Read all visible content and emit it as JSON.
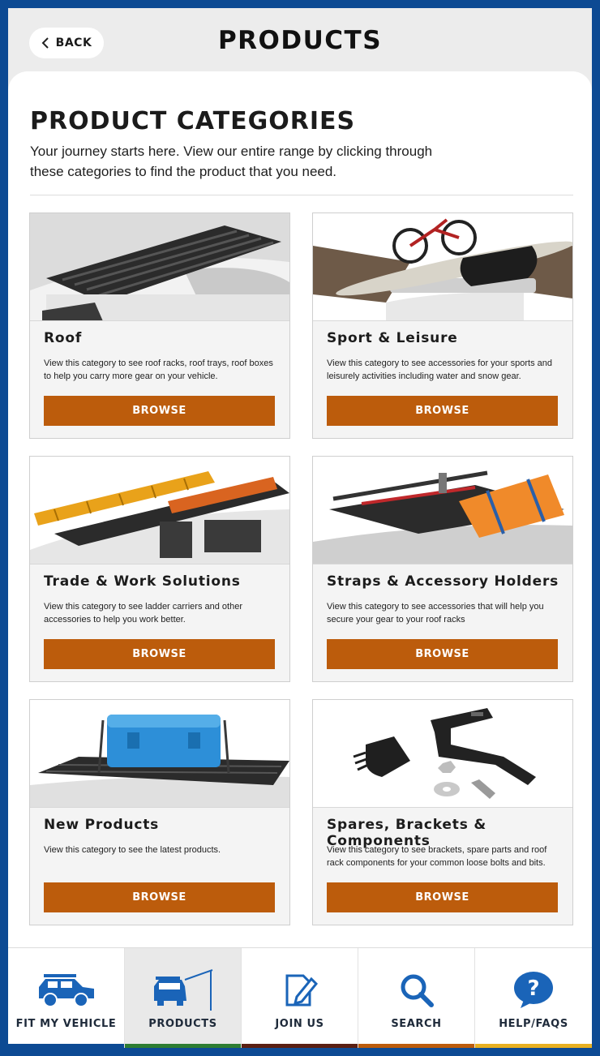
{
  "header": {
    "back_label": "BACK",
    "title": "PRODUCTS"
  },
  "section": {
    "title": "PRODUCT CATEGORIES",
    "intro": "Your journey starts here. View our entire range by clicking through these categories to find the product that you need."
  },
  "categories": [
    {
      "title": "Roof",
      "description": "View this category to see roof racks, roof trays, roof boxes to help you carry more gear on your vehicle.",
      "button": "BROWSE",
      "image_icon": "roof-rack-image"
    },
    {
      "title": "Sport & Leisure",
      "description": "View this category to see accessories for your sports and leisurely activities including water and snow gear.",
      "button": "BROWSE",
      "image_icon": "bike-kayak-image"
    },
    {
      "title": "Trade & Work Solutions",
      "description": "View this category to see ladder carriers and other accessories to help you work better.",
      "button": "BROWSE",
      "image_icon": "ladder-rack-image"
    },
    {
      "title": "Straps & Accessory Holders",
      "description": "View this category to see accessories that will help you secure your gear to your roof racks",
      "button": "BROWSE",
      "image_icon": "recovery-boards-image"
    },
    {
      "title": "New Products",
      "description": "View this category to see the latest products.",
      "button": "BROWSE",
      "image_icon": "blue-case-image"
    },
    {
      "title": "Spares, Brackets & Components",
      "description": "View this category to see brackets, spare parts and roof rack components for your common loose bolts and bits.",
      "button": "BROWSE",
      "image_icon": "bracket-parts-image"
    }
  ],
  "nav": [
    {
      "label": "FIT MY VEHICLE",
      "icon": "vehicle-icon",
      "bar_color": "#0d4a93",
      "active": false
    },
    {
      "label": "PRODUCTS",
      "icon": "vehicle-awning-icon",
      "bar_color": "#2e7d32",
      "active": true
    },
    {
      "label": "JOIN US",
      "icon": "edit-document-icon",
      "bar_color": "#5a1f12",
      "active": false
    },
    {
      "label": "SEARCH",
      "icon": "search-icon",
      "bar_color": "#bc5c0c",
      "active": false
    },
    {
      "label": "HELP/FAQS",
      "icon": "help-icon",
      "bar_color": "#e8b021",
      "active": false
    }
  ],
  "colors": {
    "brand_blue": "#0d4a93",
    "button_orange": "#bc5c0c"
  }
}
